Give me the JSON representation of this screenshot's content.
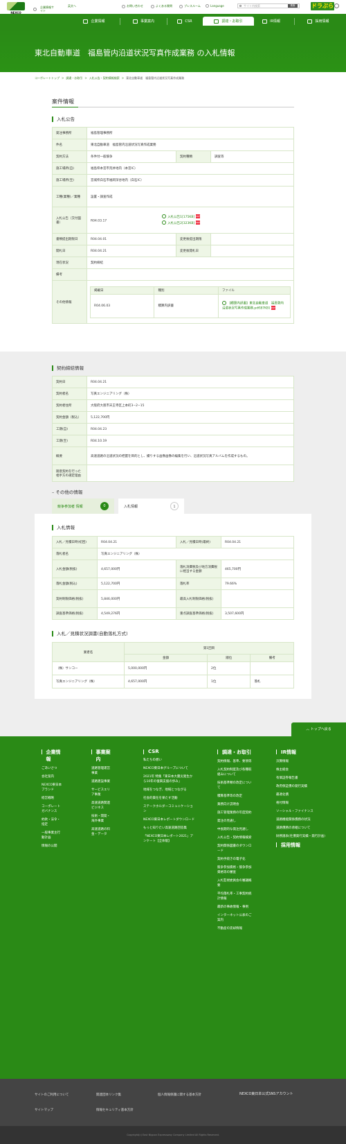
{
  "header": {
    "logo_text": "NEXCO",
    "site_link": "企業情報サイト",
    "lang_top": "英文へ",
    "util": [
      "お問い合わせ",
      "よくある質問",
      "プレスルーム",
      "Language"
    ],
    "search_placeholder": "サイト内検索",
    "search_button": "検索",
    "dorapura": "ドラぷら"
  },
  "nav": [
    {
      "label": "企業情報",
      "icon": "building-icon"
    },
    {
      "label": "事業案内",
      "icon": "road-icon"
    },
    {
      "label": "CSR",
      "icon": "heart-icon"
    },
    {
      "label": "調達・お取引",
      "icon": "handshake-icon",
      "active": true
    },
    {
      "label": "IR情報",
      "icon": "chart-icon"
    },
    {
      "label": "採用情報",
      "icon": "person-icon"
    }
  ],
  "banner": {
    "title": "東北自動車道　福島管内沿道状況写真作成業務 の入札情報"
  },
  "breadcrumb": [
    "コーポレートトップ",
    "調達・お取引",
    "入札公告・契約情報検索",
    "東北自動車道　福島管内沿道状況写真作成業務"
  ],
  "case": {
    "heading": "案件情報",
    "notice_heading": "入札公告",
    "rows": [
      {
        "k": "発注事務所",
        "v": "福島管理事務所"
      },
      {
        "k": "件名",
        "v": "東北自動車道　福島管内沿道状況写真作成業務"
      },
      {
        "k": "契約方法",
        "v": "条件付一般競争",
        "k2": "契約種類",
        "v2": "調査等"
      },
      {
        "k": "施工場所(自)",
        "v": "福島県本宮市荒井地内（本宮IC）"
      },
      {
        "k": "施工場所(至)",
        "v": "宮城県白石市福岡深谷地内（白石IC）"
      },
      {
        "k": "工種(業種)／業種",
        "v": "設置・調査作成"
      },
      {
        "k": "入札公告（交付図書）",
        "v": "R04.03.17",
        "files": [
          "入札公告1[175KB]",
          "入札公告2[323KB]"
        ]
      },
      {
        "k": "書類提出期限日",
        "v": "R04.04.01",
        "k2": "変更後提出期限",
        "v2": ""
      },
      {
        "k": "開札日",
        "v": "R04.04.21",
        "k2": "変更後開札日",
        "v2": ""
      },
      {
        "k": "現在状況",
        "v": "契約締結"
      },
      {
        "k": "備考",
        "v": ""
      }
    ],
    "other_label": "その他情報",
    "other_head": [
      "掲載日",
      "種別",
      "ファイル"
    ],
    "other_row": [
      "R04.06.03",
      "積算内訳書",
      "【積算内訳書】東北自動車道　福島管内沿道状況写真作成業務.pdf[87KB]"
    ]
  },
  "contract": {
    "heading": "契約締結情報",
    "rows": [
      {
        "k": "契約日",
        "v": "R04.04.21"
      },
      {
        "k": "契約者名",
        "v": "写真エンジニアリング（株）"
      },
      {
        "k": "契約者住所",
        "v": "大阪府大阪市天王寺区上本町3−2−15"
      },
      {
        "k": "契約金額（税込）",
        "v": "5,122,700円"
      },
      {
        "k": "工期(自)",
        "v": "R04.04.23"
      },
      {
        "k": "工期(至)",
        "v": "R04.10.19"
      },
      {
        "k": "概要",
        "v": "高速道路の沿道状況の把握を目的とし、撮りする画像画像の編集を行い、沿道状況写真アルバムを作成するもの。"
      },
      {
        "k": "随意契約を行った相手方の選定理由",
        "v": ""
      }
    ]
  },
  "other_info": {
    "heading": "その他の情報",
    "tabs": [
      {
        "label": "競争参加者 情報",
        "badge": "0"
      },
      {
        "label": "入札情報",
        "badge": "1"
      }
    ]
  },
  "bid": {
    "heading": "入札情報",
    "rows": [
      {
        "k": "入札／見積日時(初回)",
        "v": "R04.04.21",
        "k2": "入札／見積日時(最終)",
        "v2": "R04.04.21"
      },
      {
        "k": "落札者名",
        "v": "写真エンジニアリング（株）"
      },
      {
        "k": "入札金額(税抜)",
        "v": "4,657,000円",
        "k2": "落札消費税及び地方消費税に相当する金額",
        "v2": "465,700円"
      },
      {
        "k": "落札金額(税込)",
        "v": "5,122,700円",
        "k2": "落札率",
        "v2": "79.66%"
      },
      {
        "k": "契約制限価格(税抜)",
        "v": "5,846,000円",
        "k2": "最高入札制限価格(税抜)",
        "v2": ""
      },
      {
        "k": "調査基準価格(税抜)",
        "v": "4,549,276円",
        "k2": "重点調査基準価格(税抜)",
        "v2": "3,507,600円"
      }
    ]
  },
  "estimate": {
    "heading": "入札／見積状況調書(自動落札方式)",
    "col_name": "業者名",
    "round": "第1回目",
    "sub": [
      "金額",
      "順位",
      "備考"
    ],
    "rows": [
      [
        "（株）サンコー",
        "5,000,000円",
        "2位",
        ""
      ],
      [
        "写真エンジニアリング（株）",
        "4,657,000円",
        "1位",
        "落札"
      ]
    ]
  },
  "totop": "トップへ戻る",
  "footer": {
    "cols": [
      {
        "head": "企業情報",
        "links": [
          "ごあいさつ",
          "会社案内",
          "NEXCO東日本ブランド",
          "経営戦略",
          "コーポレートガバナンス",
          "約款・法令・指定",
          "一般事業主行動計画",
          "情報の公開"
        ]
      },
      {
        "head": "事業案内",
        "links": [
          "道路管理運営事業",
          "道路建設事業",
          "サービスエリア事業",
          "高速道路関連ビジネス",
          "技術・開発・海外事業",
          "高速道路の料金・データ"
        ]
      },
      {
        "head": "CSR",
        "links": [
          "私たちの想い",
          "NEXCO東日本グループについて",
          "2021年 特集「東日本大震災発生から10年の復興支援の歩み」",
          "地域をつなぎ、地域とつながる",
          "社会的責任を果たす活動",
          "ステークホルダーコミュニケーション",
          "NEXCO東日本レポートダウンロード",
          "もっと知りたい高速道路回答集",
          "「NEXCO東日本レポート2021」アンケート【全体版】"
        ]
      },
      {
        "head": "調達・お取引",
        "links": [
          "契約情報、基準、要領等",
          "入札契約制度及び各種取組みについて",
          "技術基準類の改定について",
          "積算基準等の改定",
          "業務向け説明会",
          "施工管理業務の年度契約",
          "発注の見通し",
          "中長期的な発注見通し",
          "入札公告・契約情報検索",
          "契約関係図書のダウンロード",
          "契約手続きの電子化",
          "競争参加資格・競争参加資格等の審査",
          "入札監視委員会の審議概要",
          "平均落札率・工事契約統計情報",
          "最新の事故情報・事例",
          "インターネット公表のご案内",
          "不動産の売却情報"
        ]
      },
      {
        "head": "IR情報",
        "links": [
          "決算情報",
          "株主総会",
          "有価証券報告書",
          "政府保証債の発行実績",
          "最適化債",
          "格付情報",
          "ソーシャル・ファイナンス",
          "道路機能関係債務の状況",
          "道路債務の承継について",
          "財務諸表(社債発行実績・発行計画)"
        ]
      },
      {
        "head2": "採用情報"
      }
    ],
    "bottom": [
      "サイトのご利用について",
      "関連団体リンク集",
      "個人情報保護に関する基本方針",
      "サイトマップ",
      "情報セキュリティ基本方針"
    ],
    "sns": "NEXCO東日本公式SNSアカウント",
    "copyright": "Copyright(c) East Nippon Expressway Company Limited All Rights Reserved."
  }
}
